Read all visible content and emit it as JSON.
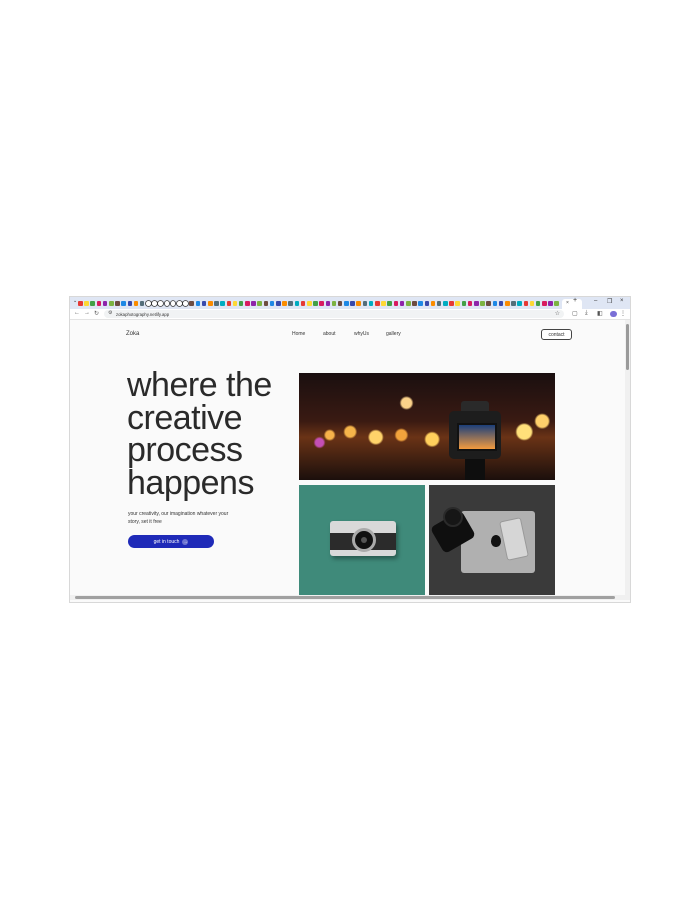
{
  "browser": {
    "url": "zokaphotography.netlify.app",
    "new_tab_label": "+",
    "tab_close_label": "×",
    "window_controls": {
      "minimize": "–",
      "restore": "❐",
      "close": "×"
    },
    "nav_icons": {
      "back": "←",
      "forward": "→",
      "reload": "↻"
    }
  },
  "site": {
    "logo": "Zoka",
    "nav": [
      "Home",
      "about",
      "whyUs",
      "gallery"
    ],
    "contact_label": "contact",
    "headline": [
      "where the",
      "creative",
      "process",
      "happens"
    ],
    "subtext": "your creativity, our imagination whatever your story, set it free",
    "cta_label": "get in touch",
    "cta_icon": "→"
  },
  "photos": [
    {
      "name": "dslr-camera-bokeh-photo",
      "icon": "camera"
    },
    {
      "name": "vintage-rangefinder-teal-photo",
      "icon": "camera"
    },
    {
      "name": "laptop-phone-camera-flatlay-photo",
      "icon": "laptop"
    }
  ],
  "colors": {
    "cta": "#1f2ab8",
    "tabstrip": "#dfe6f4",
    "teal": "#3f8a7a"
  }
}
